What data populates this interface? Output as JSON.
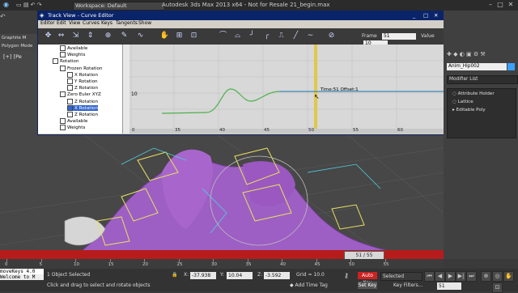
{
  "app": {
    "title": "Autodesk 3ds Max  2013 x64  - Not for Resale   21_begin.max",
    "workspace": "Workspace: Default"
  },
  "ribbon": {
    "tab1": "Graphite M",
    "tab2": "Polygon Mode"
  },
  "viewport": {
    "label": "[+] [Pe"
  },
  "trackview": {
    "title": "Track View - Curve Editor",
    "menu": [
      "Editor",
      "Edit",
      "View",
      "Curves",
      "Keys",
      "Tangents",
      "Show"
    ],
    "frame_label": "Frame",
    "frame_value": "51",
    "value_label": "Value",
    "value_value": "10",
    "tree": [
      {
        "label": "Available",
        "indent": 3,
        "sel": false
      },
      {
        "label": "Weights",
        "indent": 3,
        "sel": false
      },
      {
        "label": "Rotation",
        "indent": 2,
        "sel": false
      },
      {
        "label": "Frozen Rotation",
        "indent": 3,
        "sel": false
      },
      {
        "label": "X Rotation",
        "indent": 4,
        "sel": false
      },
      {
        "label": "Y Rotation",
        "indent": 4,
        "sel": false
      },
      {
        "label": "Z Rotation",
        "indent": 4,
        "sel": false
      },
      {
        "label": "Zero Euler XYZ",
        "indent": 3,
        "sel": false
      },
      {
        "label": "Z Rotation",
        "indent": 4,
        "sel": false
      },
      {
        "label": "X Rotation",
        "indent": 4,
        "sel": true
      },
      {
        "label": "Z Rotation",
        "indent": 4,
        "sel": false
      },
      {
        "label": "Available",
        "indent": 3,
        "sel": false
      },
      {
        "label": "Weights",
        "indent": 3,
        "sel": false
      }
    ],
    "curve_value_label": "10",
    "readout": "Time:51  Offset:1",
    "axis_ticks": [
      "0",
      "35",
      "40",
      "45",
      "50",
      "55",
      "60"
    ]
  },
  "right_panel": {
    "object_name": "Anim_Hip002",
    "modifier_list": "Modifier List",
    "stack": [
      "Attribute Holder",
      "Lattice",
      "Editable Poly"
    ]
  },
  "timeline": {
    "slider_label": "51 / 55",
    "ruler_labels": [
      "0",
      "5",
      "10",
      "15",
      "20",
      "25",
      "30",
      "35",
      "40",
      "45",
      "50",
      "55"
    ]
  },
  "status": {
    "script": "moveKeys 4.0",
    "script2": "Welcome to M",
    "selection": "1 Object Selected",
    "prompt": "Click and drag to select and rotate objects",
    "x_label": "X:",
    "x_value": "-37.938",
    "y_label": "Y:",
    "y_value": "10.04",
    "z_label": "Z:",
    "z_value": "-3.592",
    "grid": "Grid = 10.0",
    "add_time_tag": "Add Time Tag",
    "auto_key": "Auto Key",
    "set_key": "Set Key",
    "selected_dd": "Selected",
    "key_filters": "Key Filters...",
    "frame": "51"
  }
}
